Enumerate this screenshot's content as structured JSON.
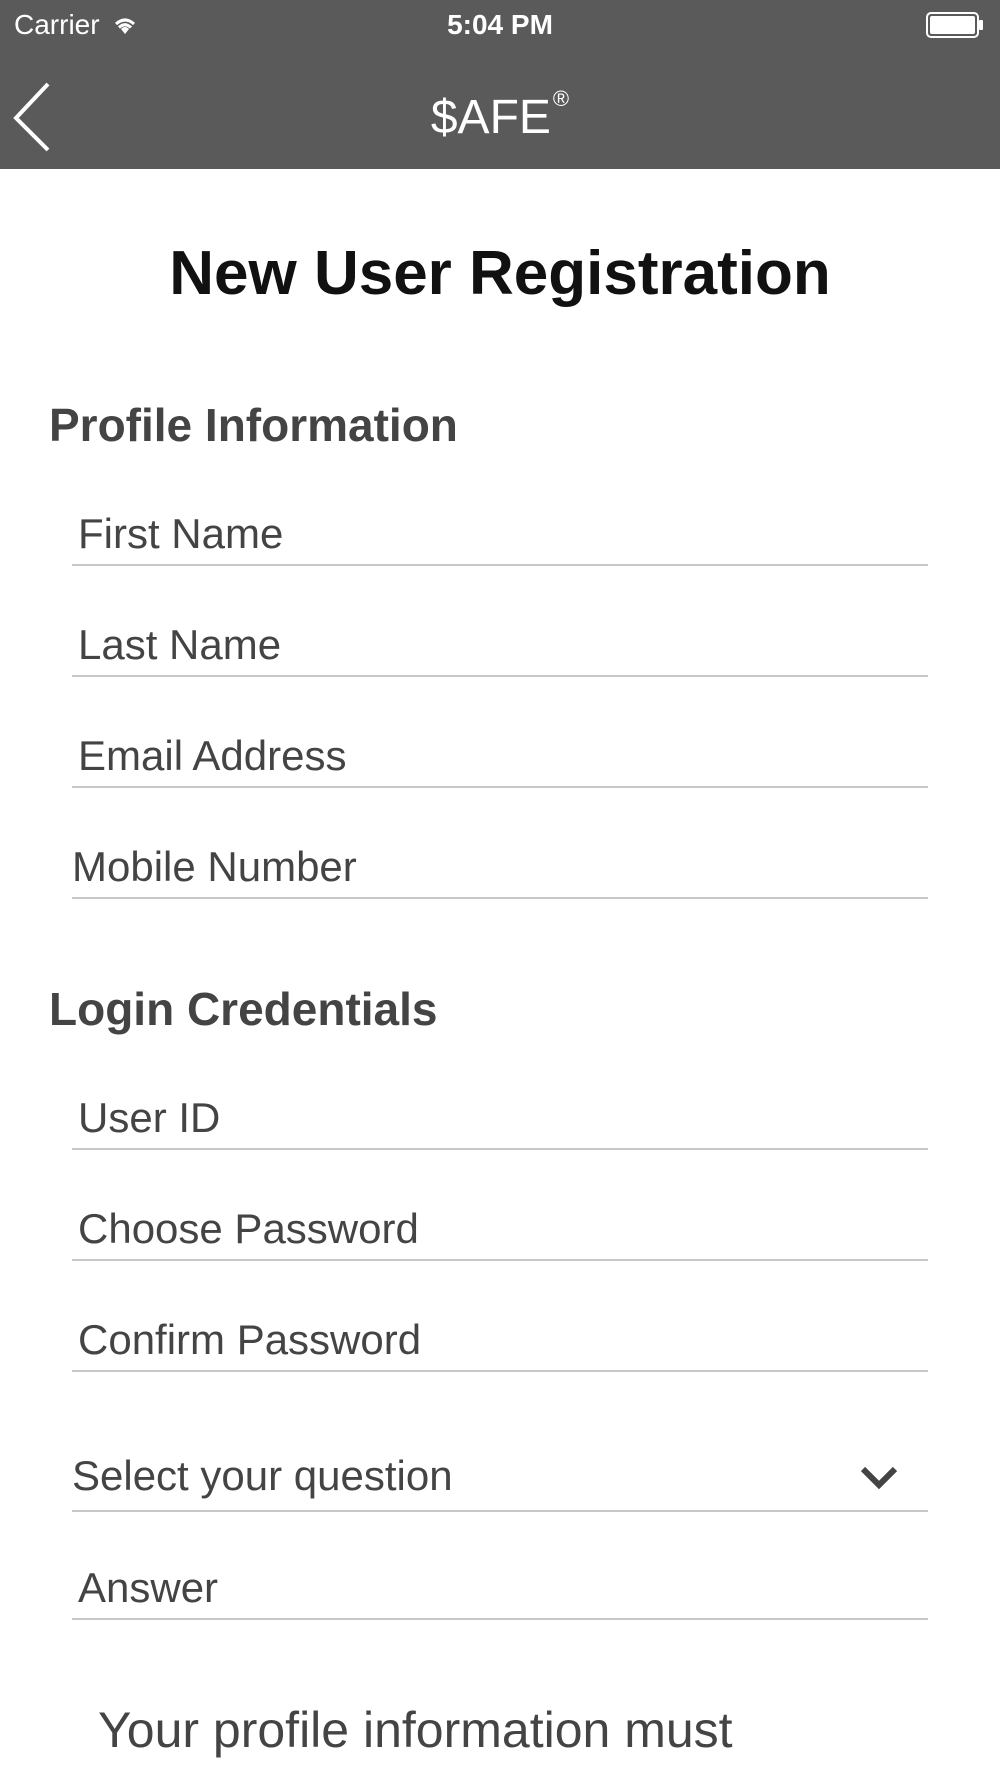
{
  "status_bar": {
    "carrier": "Carrier",
    "time": "5:04 PM",
    "icons": [
      "wifi-icon",
      "battery-icon"
    ]
  },
  "nav": {
    "title": "$AFE",
    "title_mark": "®",
    "back_icon": "chevron-left-icon"
  },
  "page": {
    "title": "New User Registration"
  },
  "profile": {
    "heading": "Profile Information",
    "first_name_placeholder": "First Name",
    "last_name_placeholder": "Last Name",
    "email_placeholder": "Email Address",
    "mobile_placeholder": "Mobile Number"
  },
  "credentials": {
    "heading": "Login Credentials",
    "user_id_placeholder": "User ID",
    "password_placeholder": "Choose Password",
    "confirm_password_placeholder": "Confirm Password",
    "question_select": "Select your question",
    "answer_placeholder": "Answer"
  },
  "footer_text": "Your profile information must",
  "colors": {
    "header_bg": "#5a5a5a",
    "divider": "#c8c8c8"
  }
}
